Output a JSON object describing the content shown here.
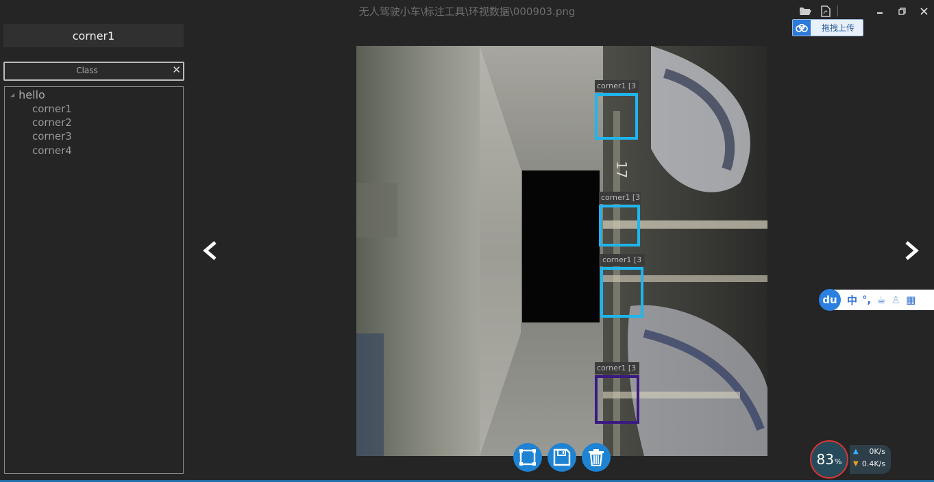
{
  "window": {
    "title": "无人驾驶小车\\标注工具\\环视数据\\000903.png",
    "icons": [
      "folder-open-icon",
      "export-pdf-icon",
      "minimize-icon",
      "restore-icon",
      "close-icon"
    ]
  },
  "upload": {
    "label": "拖拽上传"
  },
  "sidebar": {
    "selected_label": "corner1",
    "search": {
      "placeholder": "Class",
      "value": ""
    },
    "tree": {
      "root": "hello",
      "children": [
        "corner1",
        "corner2",
        "corner3",
        "corner4"
      ]
    }
  },
  "annotations": [
    {
      "label": "corner1 [3",
      "color": "#1eb6ef"
    },
    {
      "label": "corner1 [3",
      "color": "#1eb6ef"
    },
    {
      "label": "corner1 [3",
      "color": "#1eb6ef"
    },
    {
      "label": "corner1 [3",
      "color": "#3a1a80"
    }
  ],
  "toolbar": {
    "buttons": [
      "draw-rect-icon",
      "save-icon",
      "delete-icon"
    ]
  },
  "ime": {
    "logo": "du",
    "mode": "中",
    "punct": "°,"
  },
  "network": {
    "percent": "83",
    "percent_unit": "%",
    "upload": "0K/s",
    "download": "0.4K/s"
  },
  "colors": {
    "accent": "#1f83d3",
    "box": "#1eb6ef"
  }
}
